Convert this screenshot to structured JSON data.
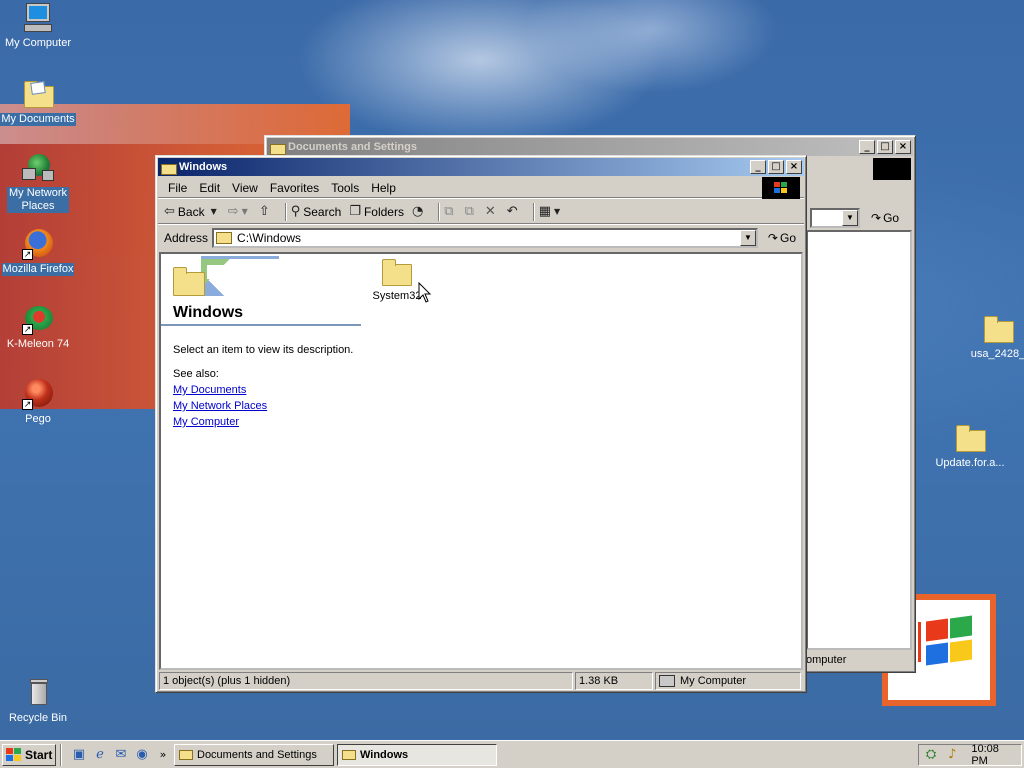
{
  "desktop": {
    "icons": [
      {
        "label": "My Computer"
      },
      {
        "label": "My Documents"
      },
      {
        "label": "My Network Places"
      },
      {
        "label": "Mozilla Firefox"
      },
      {
        "label": "K-Meleon 74"
      },
      {
        "label": "Pego"
      },
      {
        "label": "Recycle Bin"
      },
      {
        "label": "usa_2428_"
      },
      {
        "label": "Update.for.a..."
      }
    ]
  },
  "back_window": {
    "title": "Documents and Settings",
    "go_label": "Go",
    "status_location": "omputer"
  },
  "front_window": {
    "title": "Windows",
    "menu": [
      "File",
      "Edit",
      "View",
      "Favorites",
      "Tools",
      "Help"
    ],
    "toolbar": {
      "back": "Back",
      "search": "Search",
      "folders": "Folders"
    },
    "address": {
      "label": "Address",
      "value": "C:\\Windows",
      "go_label": "Go"
    },
    "sidebar": {
      "title": "Windows",
      "description": "Select an item to view its description.",
      "see_also": "See also:",
      "links": [
        "My Documents",
        "My Network Places",
        "My Computer"
      ]
    },
    "files": [
      {
        "name": "System32"
      }
    ],
    "status": {
      "objects": "1 object(s) (plus 1 hidden)",
      "size": "1.38 KB",
      "location": "My Computer"
    }
  },
  "taskbar": {
    "start_label": "Start",
    "tasks": [
      "Documents and Settings",
      "Windows"
    ],
    "clock": "10:08 PM"
  },
  "colors": {
    "desktop": "#3a6ea5",
    "title_active": "#0a246a",
    "title_inactive": "#808080",
    "face": "#d4d0c8"
  }
}
